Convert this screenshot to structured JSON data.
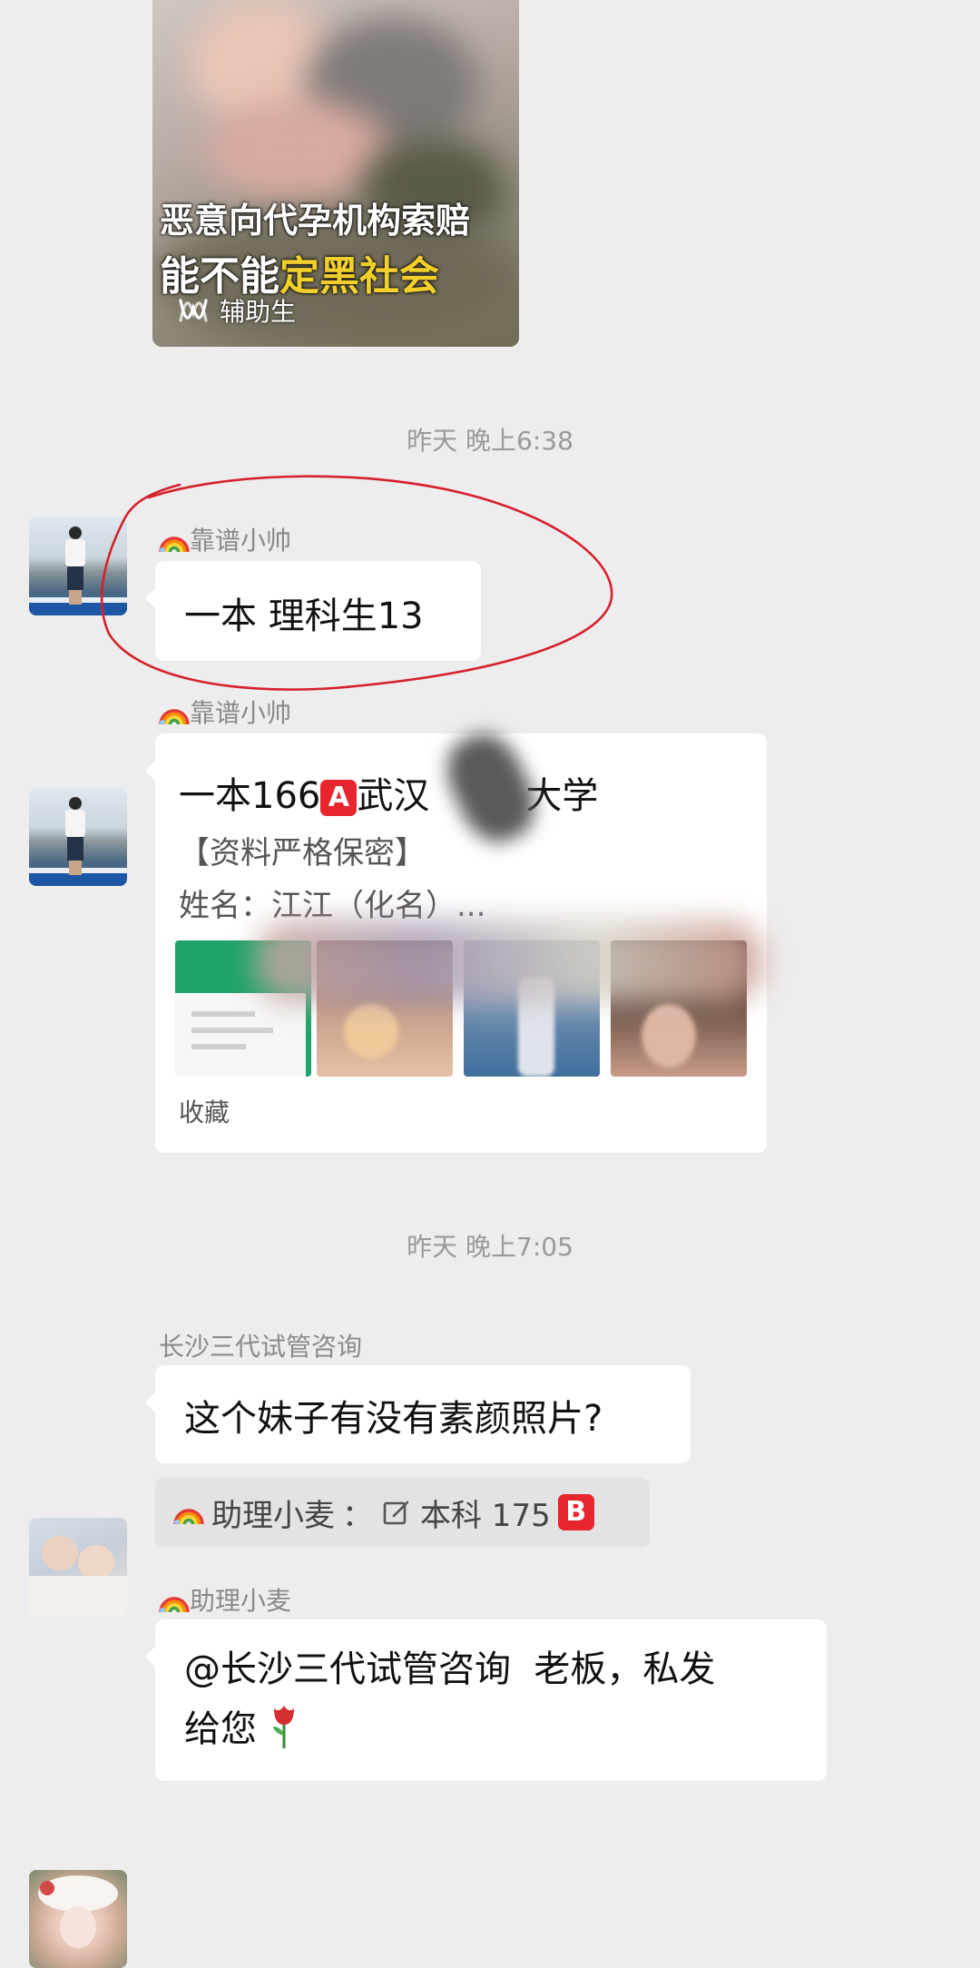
{
  "video_card": {
    "caption_line1": "恶意向代孕机构索赔",
    "caption_line2_white": "能不能",
    "caption_line2_yellow": "定黑社会",
    "source": "辅助生"
  },
  "timestamps": [
    "昨天 晚上6:38",
    "昨天 晚上7:05"
  ],
  "messages": {
    "m1": {
      "sender": "靠谱小帅",
      "text": "一本 理科生13"
    },
    "m2": {
      "sender": "靠谱小帅",
      "card": {
        "line1_prefix": "一本166",
        "line1_badge": "A",
        "line1_mid": "武汉",
        "line1_suffix": "大学",
        "line2": "【资料严格保密】",
        "line3": "姓名：江江（化名）...",
        "footer": "收藏"
      }
    },
    "m3": {
      "sender": "长沙三代试管咨询",
      "text": "这个妹子有没有素颜照片?"
    },
    "quote": {
      "sender": "助理小麦",
      "text": "本科 175",
      "badge": "B"
    },
    "m4": {
      "sender": "助理小麦",
      "text_line1": "@长沙三代试管咨询  老板，私发",
      "text_line2": "给您"
    }
  },
  "colors": {
    "background": "#ededed",
    "bubble": "#ffffff",
    "timestamp": "#9a9a9a",
    "annotation": "#d6202a",
    "badge": "#e8262d"
  }
}
